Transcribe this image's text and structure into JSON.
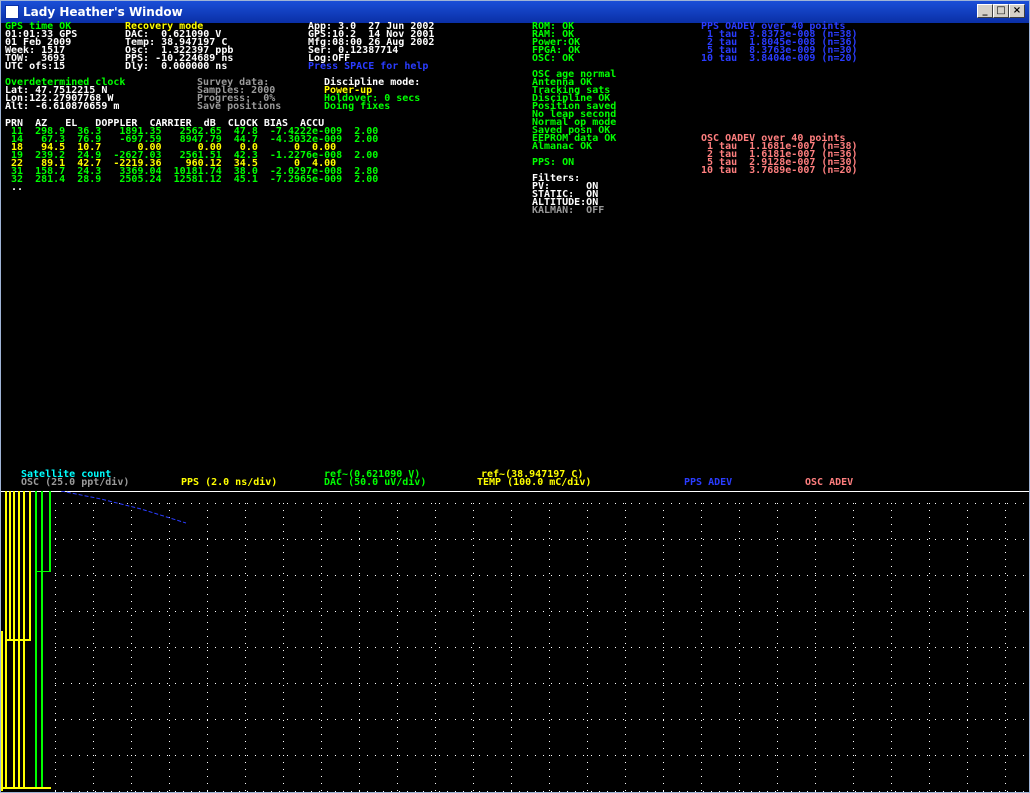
{
  "window": {
    "title": "Lady Heather's Window"
  },
  "header_col1": [
    {
      "text": "GPS time OK",
      "color": "green"
    },
    {
      "text": "01:01:33 GPS",
      "color": "white"
    },
    {
      "text": "01 Feb 2009",
      "color": "white"
    },
    {
      "text": "Week: 1517",
      "color": "white"
    },
    {
      "text": "TOW:  3693",
      "color": "white"
    },
    {
      "text": "UTC ofs:15",
      "color": "white"
    }
  ],
  "header_col2": [
    {
      "text": "Recovery mode",
      "color": "yellow"
    },
    {
      "text": "DAC:  0.621090 V",
      "color": "white"
    },
    {
      "text": "Temp: 38.947197 C",
      "color": "white"
    },
    {
      "text": "Osc:  1.322397 ppb",
      "color": "white"
    },
    {
      "text": "PPS: -10.224689 ns",
      "color": "white"
    },
    {
      "text": "Dly:  0.000000 ns",
      "color": "white"
    }
  ],
  "header_col3": [
    {
      "text": "App: 3.0  27 Jun 2002",
      "color": "white"
    },
    {
      "text": "GPS:10.2  14 Nov 2001",
      "color": "white"
    },
    {
      "text": "Mfg:08:00 26 Aug 2002",
      "color": "white"
    },
    {
      "text": "Ser: 0.12387714",
      "color": "white"
    },
    {
      "text": "Log:OFF",
      "color": "white"
    },
    {
      "text": "Press SPACE for help",
      "color": "blue"
    }
  ],
  "status_col": [
    {
      "text": "ROM: OK",
      "color": "green"
    },
    {
      "text": "RAM: OK",
      "color": "green"
    },
    {
      "text": "Power:OK",
      "color": "green"
    },
    {
      "text": "FPGA: OK",
      "color": "green"
    },
    {
      "text": "OSC: OK",
      "color": "green"
    }
  ],
  "pps_adev": [
    {
      "text": "PPS OADEV over 40 points",
      "color": "blue"
    },
    {
      "text": " 1 tau  3.8373e-008 (n=38)",
      "color": "blue"
    },
    {
      "text": " 2 tau  1.8045e-008 (n=36)",
      "color": "blue"
    },
    {
      "text": " 5 tau  8.3763e-009 (n=30)",
      "color": "blue"
    },
    {
      "text": "10 tau  3.8404e-009 (n=20)",
      "color": "blue"
    }
  ],
  "position": [
    {
      "text": "Overdetermined clock",
      "color": "green"
    },
    {
      "text": "Lat: 47.7512215 N",
      "color": "white"
    },
    {
      "text": "Lon:122.27907768 W",
      "color": "white"
    },
    {
      "text": "Alt: -6.610870659 m",
      "color": "white"
    }
  ],
  "survey": [
    {
      "text": "Survey data:",
      "color": "grey"
    },
    {
      "text": "Samples: 2000",
      "color": "grey"
    },
    {
      "text": "Progress:  0%",
      "color": "grey"
    },
    {
      "text": "Save positions",
      "color": "grey"
    }
  ],
  "discipline": [
    {
      "text": "Discipline mode:",
      "color": "white"
    },
    {
      "text": "Power-up",
      "color": "yellow"
    },
    {
      "text": "Holdover: 0 secs",
      "color": "green"
    },
    {
      "text": "Doing fixes",
      "color": "green"
    }
  ],
  "alarms": [
    {
      "text": "OSC age normal",
      "color": "green"
    },
    {
      "text": "Antenna OK",
      "color": "green"
    },
    {
      "text": "Tracking sats",
      "color": "green"
    },
    {
      "text": "Discipline OK",
      "color": "green"
    },
    {
      "text": "Position saved",
      "color": "green"
    },
    {
      "text": "No leap second",
      "color": "green"
    },
    {
      "text": "Normal op mode",
      "color": "green"
    },
    {
      "text": "Saved posn OK",
      "color": "green"
    },
    {
      "text": "EEPROM data OK",
      "color": "green"
    },
    {
      "text": "Almanac OK",
      "color": "green"
    },
    {
      "text": "",
      "color": "green"
    },
    {
      "text": "PPS: ON",
      "color": "green"
    },
    {
      "text": "",
      "color": "green"
    },
    {
      "text": "Filters:",
      "color": "white"
    },
    {
      "text": "PV:      ON",
      "color": "white"
    },
    {
      "text": "STATIC:  ON",
      "color": "white"
    },
    {
      "text": "ALTITUDE:ON",
      "color": "white"
    },
    {
      "text": "KALMAN:  OFF",
      "color": "grey"
    }
  ],
  "osc_adev": [
    {
      "text": "OSC OADEV over 40 points",
      "color": "pink"
    },
    {
      "text": " 1 tau  1.1681e-007 (n=38)",
      "color": "pink"
    },
    {
      "text": " 2 tau  1.6181e-007 (n=36)",
      "color": "pink"
    },
    {
      "text": " 5 tau  2.9128e-007 (n=30)",
      "color": "pink"
    },
    {
      "text": "10 tau  3.7689e-007 (n=20)",
      "color": "pink"
    }
  ],
  "sat_table": {
    "header": "PRN  AZ   EL   DOPPLER  CARRIER  dB  CLOCK BIAS  ACCU",
    "rows": [
      {
        "text": " 11  298.9  36.3   1891.35   2562.65  47.8  -7.4222e-009  2.00",
        "color": "green"
      },
      {
        "text": " 14   67.3  76.9   -697.59   8947.79  44.7  -4.3032e-009  2.00",
        "color": "green"
      },
      {
        "text": " 18   94.5  10.7      0.00      0.00   0.0      0  0.00",
        "color": "yellow"
      },
      {
        "text": " 19  239.2  24.9  -2627.03   2561.51  42.3  -1.2276e-008  2.00",
        "color": "green"
      },
      {
        "text": " 22   89.1  42.7  -2219.36    960.12  34.5      0  4.00",
        "color": "yellow"
      },
      {
        "text": " 31  158.7  24.3   3369.04  10181.74  38.0  -2.0297e-008  2.80",
        "color": "green"
      },
      {
        "text": " 32  281.4  28.9   2505.24  12581.12  45.1  -7.2965e-009  2.00",
        "color": "green"
      },
      {
        "text": " ..",
        "color": "white"
      }
    ]
  },
  "plot_labels": [
    {
      "text": "Satellite count",
      "color": "cyan"
    },
    {
      "text": "OSC (25.0 ppt/div)",
      "color": "grey"
    },
    {
      "text": "PPS (2.0 ns/div)",
      "color": "yellow"
    },
    {
      "text": "ref~(0.621090 V)",
      "color": "green"
    },
    {
      "text": "DAC (50.0 uV/div)",
      "color": "green"
    },
    {
      "text": "ref~(38.947197 C)",
      "color": "yellow"
    },
    {
      "text": "TEMP (100.0 mC/div)",
      "color": "yellow"
    },
    {
      "text": "PPS ADEV",
      "color": "blue"
    },
    {
      "text": "OSC ADEV",
      "color": "pink"
    }
  ],
  "colors": {
    "green": "#00ff00",
    "yellow": "#ffff00",
    "white": "#ffffff",
    "grey": "#9a9a9a",
    "blue": "#2a3cff",
    "pink": "#ff7f7f",
    "cyan": "#00ffff"
  }
}
